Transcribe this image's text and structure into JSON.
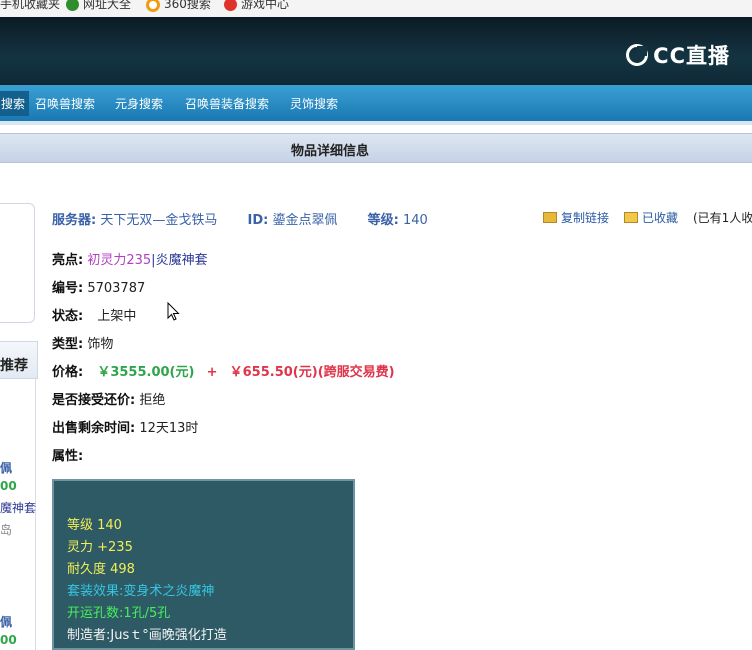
{
  "bookmarks": [
    {
      "label": "手机收藏夹"
    },
    {
      "label": "网址大全"
    },
    {
      "label": "360搜索"
    },
    {
      "label": "游戏中心"
    }
  ],
  "brand": {
    "logo_text": "CC直播"
  },
  "nav": {
    "items": [
      {
        "label": "搜索"
      },
      {
        "label": "召唤兽搜索"
      },
      {
        "label": "元身搜索"
      },
      {
        "label": "召唤兽装备搜索"
      },
      {
        "label": "灵饰搜索"
      }
    ]
  },
  "section": {
    "title": "物品详细信息"
  },
  "sidebar": {
    "recommend_label": "推荐",
    "lines": [
      "佩",
      "00",
      "魔神套",
      "岛",
      "佩",
      "00"
    ]
  },
  "item": {
    "server_label": "服务器:",
    "server_value": "天下无双—金戈铁马",
    "id_label": "ID:",
    "id_value": "鎏金点翠佩",
    "level_label": "等级:",
    "level_value": "140",
    "copy_link": "复制链接",
    "favorited": "已收藏",
    "favorite_count": "(已有1人收",
    "highlight_label": "亮点:",
    "highlight_1": "初灵力235",
    "highlight_sep": "|",
    "highlight_2": "炎魔神套",
    "number_label": "编号:",
    "number_value": "5703787",
    "status_label": "状态:",
    "status_value": "上架中",
    "type_label": "类型:",
    "type_value": "饰物",
    "price_label": "价格:",
    "price_value": "￥3555.00(元)",
    "price_plus": "+",
    "fee_value": "￥655.50(元)(跨服交易费)",
    "bargain_label": "是否接受还价:",
    "bargain_value": "拒绝",
    "time_label": "出售剩余时间:",
    "time_value": "12天13时",
    "attr_label": "属性:"
  },
  "attributes": {
    "level": "等级 140",
    "spirit": "灵力 +235",
    "durability": "耐久度 498",
    "set_effect": "套装效果:变身术之炎魔神",
    "holes": "开运孔数:1孔/5孔",
    "maker": "制造者:Jusｔ°画晚强化打造"
  },
  "colors": {
    "nav_bg": "#1a78b3",
    "label_blue": "#3a62a8",
    "price_red": "#e0344a",
    "attr_box_bg": "#2e5a66"
  }
}
